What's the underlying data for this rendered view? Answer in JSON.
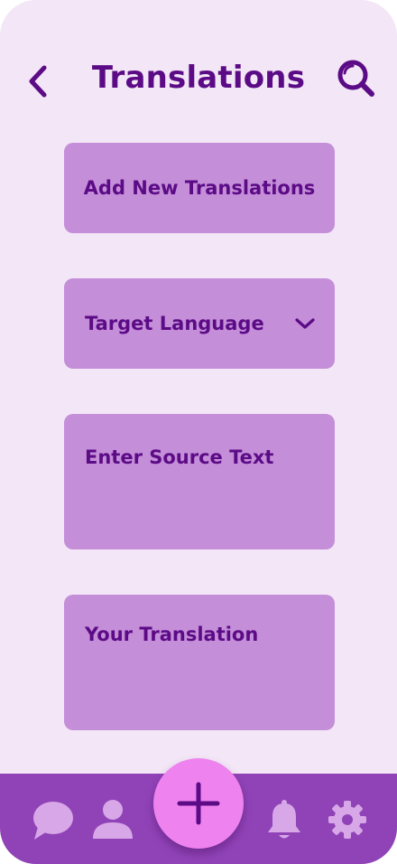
{
  "header": {
    "title": "Translations",
    "back_icon": "chevron-left-icon",
    "search_icon": "search-icon"
  },
  "cards": {
    "add_new": "Add New Translations",
    "target_language": "Target Language",
    "source_text": "Enter Source Text",
    "translation": "Your Translation"
  },
  "bottom_nav": {
    "items": [
      "chat-icon",
      "user-icon",
      "add-icon",
      "bell-icon",
      "gear-icon"
    ]
  },
  "colors": {
    "background": "#F3E6F6",
    "card": "#C48ED9",
    "text": "#5C0B86",
    "nav_bar": "#9043B7",
    "nav_icon": "#D7A7E8",
    "fab": "#EE82EE"
  }
}
